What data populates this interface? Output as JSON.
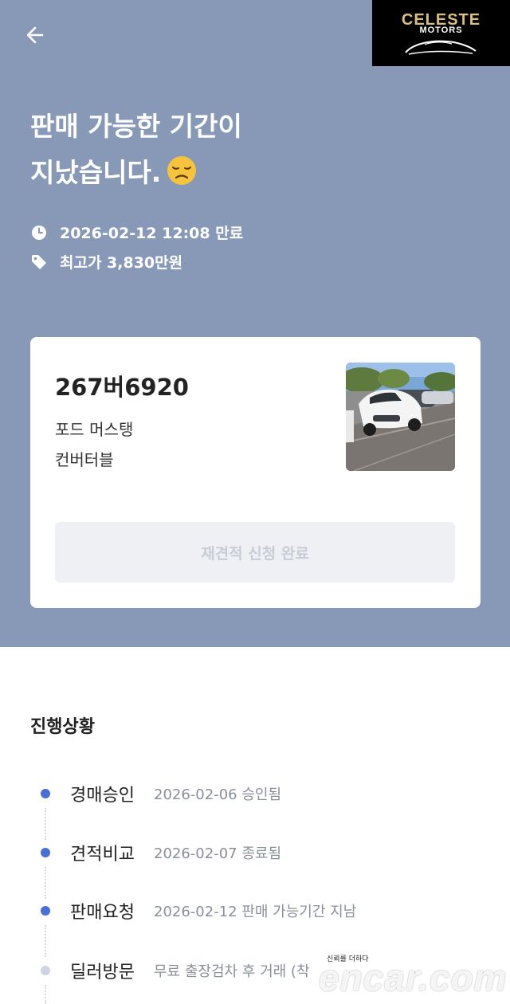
{
  "header": {
    "back_icon": "arrow-left-icon",
    "logo": {
      "title": "CELESTE",
      "subtitle": "MOTORS",
      "color": "#d8bf86"
    }
  },
  "hero": {
    "background": "#8899b8",
    "headline_line1": "판매 가능한 기간이",
    "headline_line2": "지났습니다.",
    "headline_emoji": "disappointed-face-icon",
    "expire_icon": "clock-icon",
    "expire_text": "2026-02-12 12:08 만료",
    "price_icon": "price-tag-icon",
    "price_text": "최고가 3,830만원"
  },
  "card": {
    "plate": "267버6920",
    "model": "포드 머스탱",
    "trim": "컨버터블",
    "photo": "car-photo",
    "requote_label": "재견적 신청 완료"
  },
  "progress": {
    "title": "진행상황",
    "accent": "#4a6fd4",
    "steps": [
      {
        "name": "경매승인",
        "detail": "2026-02-06 승인됨",
        "active": true
      },
      {
        "name": "견적비교",
        "detail": "2026-02-07 종료됨",
        "active": true
      },
      {
        "name": "판매요청",
        "detail": "2026-02-12 판매 가능기간 지남",
        "active": true
      },
      {
        "name": "딜러방문",
        "detail": "무료 출장검차 후 거래 (착",
        "active": false
      }
    ]
  },
  "watermark": {
    "tagline": "신뢰를 더하다",
    "brand": "encar.com"
  }
}
